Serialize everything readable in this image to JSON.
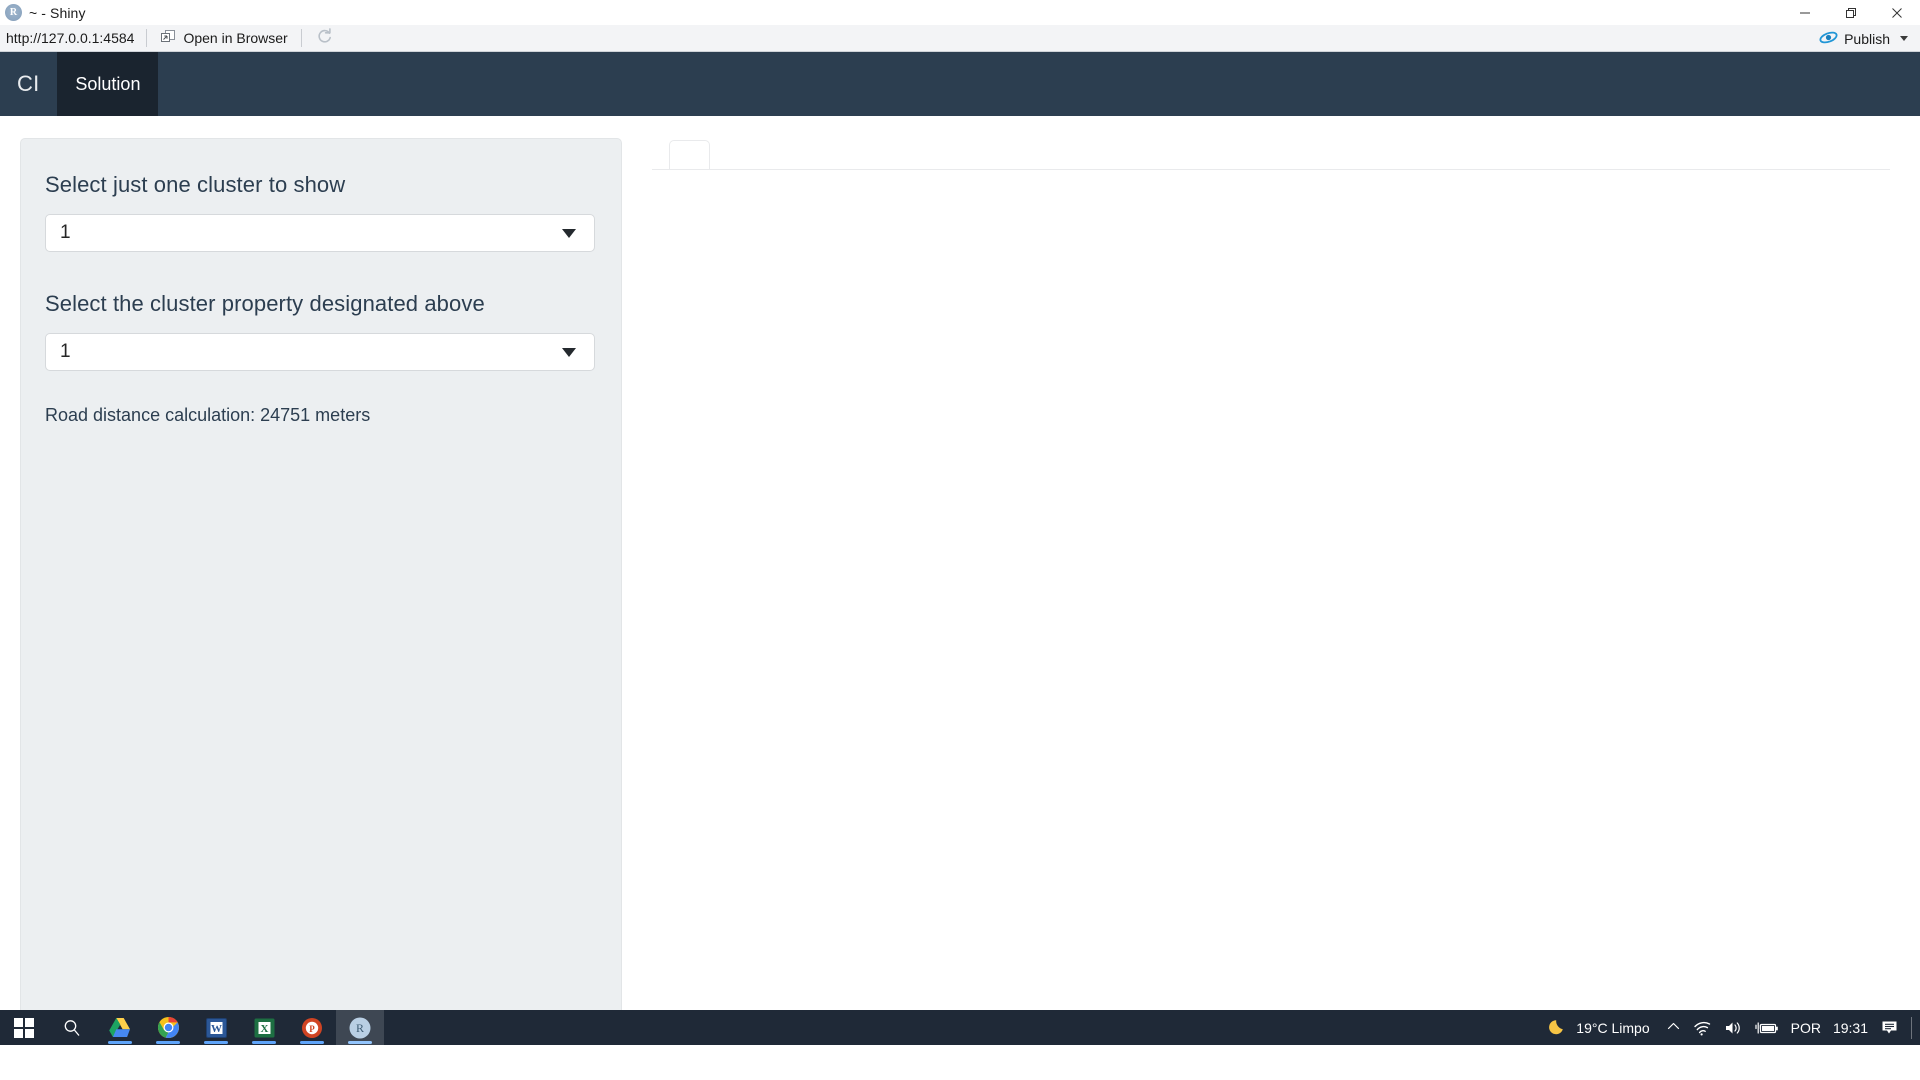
{
  "window": {
    "app_icon": "r-logo-icon",
    "title": "~ - Shiny",
    "minimize_label": "Minimize",
    "restore_label": "Restore",
    "close_label": "Close"
  },
  "toolbar": {
    "url": "http://127.0.0.1:4584",
    "open_in_browser_label": "Open in Browser",
    "open_in_browser_icon": "external-window-icon",
    "refresh_icon": "refresh-icon",
    "publish_label": "Publish",
    "publish_icon": "publish-icon",
    "publish_caret_icon": "chevron-down-icon"
  },
  "navbar": {
    "brand": "CI",
    "tabs": [
      {
        "label": "Solution",
        "active": true
      }
    ],
    "background_color": "#2c3e50",
    "active_tab_color": "#1a242f"
  },
  "sidebar": {
    "background_color": "#eceff1",
    "controls": [
      {
        "label": "Select just one cluster to show",
        "value": "1",
        "options": [
          "1"
        ]
      },
      {
        "label": "Select the cluster property designated above",
        "value": "1",
        "options": [
          "1"
        ]
      }
    ],
    "road_distance_text": "Road distance calculation: 24751 meters"
  },
  "main_panel": {
    "tabs": [
      {
        "label": ""
      }
    ]
  },
  "taskbar": {
    "start_icon": "windows-start-icon",
    "search_icon": "search-icon",
    "apps": [
      {
        "name": "google-drive-icon",
        "label": "Google Drive",
        "running": true
      },
      {
        "name": "chrome-icon",
        "label": "Google Chrome",
        "running": true
      },
      {
        "name": "word-icon",
        "label": "Microsoft Word",
        "running": true
      },
      {
        "name": "excel-icon",
        "label": "Microsoft Excel",
        "running": true
      },
      {
        "name": "powerpoint-icon",
        "label": "Microsoft PowerPoint",
        "running": true
      },
      {
        "name": "rstudio-icon",
        "label": "RStudio",
        "running": true,
        "active": true
      }
    ],
    "tray": {
      "weather_icon": "moon-icon",
      "weather_text": "19°C  Limpo",
      "overflow_icon": "chevron-up-icon",
      "network_icon": "wifi-icon",
      "volume_icon": "speaker-icon",
      "battery_icon": "battery-charging-icon",
      "language": "POR",
      "time": "19:31",
      "notifications_icon": "notification-icon"
    }
  }
}
